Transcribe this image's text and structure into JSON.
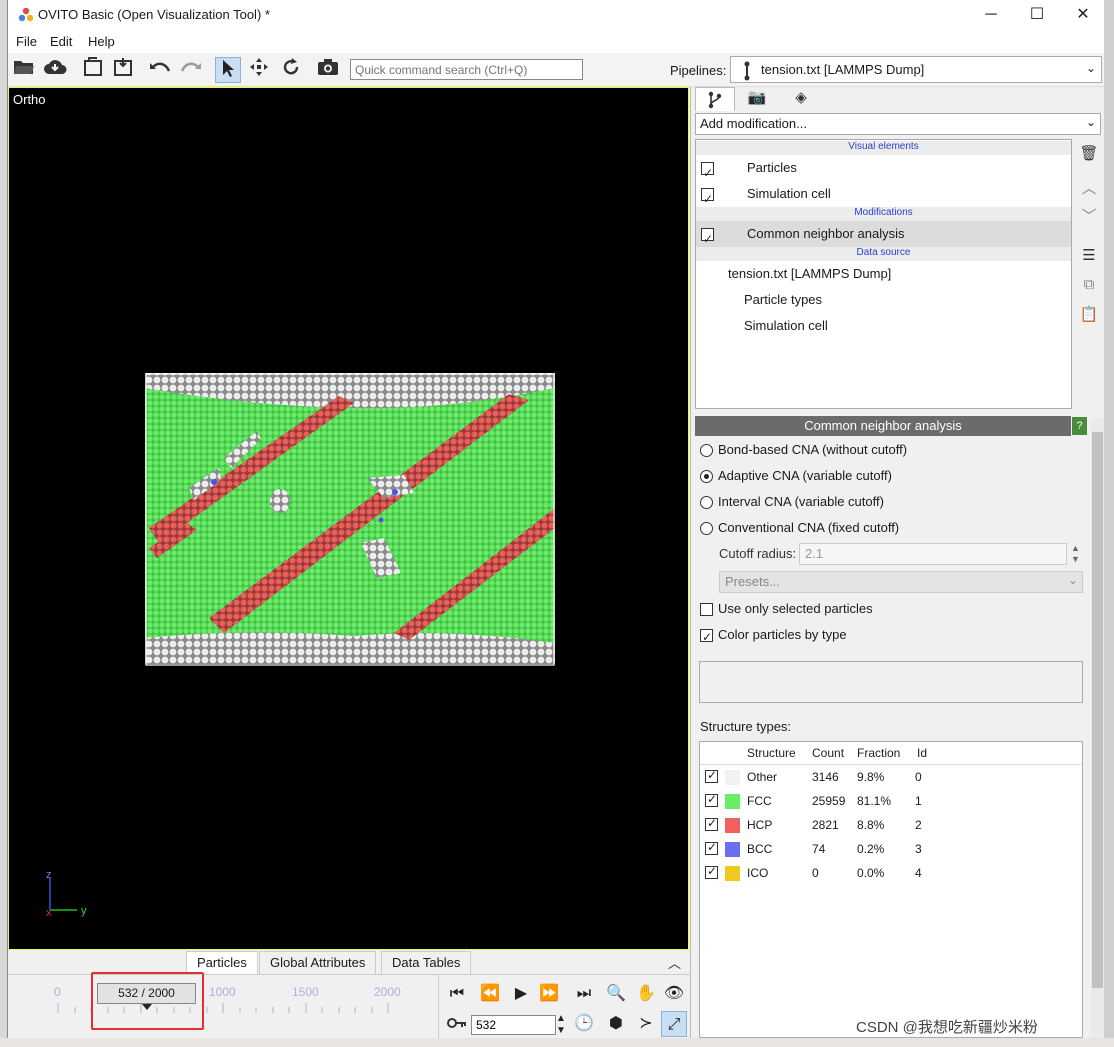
{
  "window": {
    "title": "OVITO Basic (Open Visualization Tool) *",
    "minimize": "─",
    "maximize": "☐",
    "close": "✕"
  },
  "menu": [
    "File",
    "Edit",
    "Help"
  ],
  "toolbar": {
    "search_placeholder": "Quick command search (Ctrl+Q)",
    "pipelines_label": "Pipelines:",
    "pipeline_value": "tension.txt [LAMMPS Dump]"
  },
  "viewport": {
    "label": "Ortho",
    "axis_z": "z",
    "axis_y": "y",
    "axis_x": "x"
  },
  "right_panel": {
    "add_modification": "Add modification...",
    "sections": {
      "visual_elements": "Visual elements",
      "modifications": "Modifications",
      "data_source": "Data source"
    },
    "visual_elements": [
      {
        "label": "Particles",
        "checked": true
      },
      {
        "label": "Simulation cell",
        "checked": true
      }
    ],
    "modifications": [
      {
        "label": "Common neighbor analysis",
        "checked": true,
        "selected": true
      }
    ],
    "data_source": {
      "file": "tension.txt [LAMMPS Dump]",
      "children": [
        "Particle types",
        "Simulation cell"
      ]
    }
  },
  "cna": {
    "header": "Common neighbor analysis",
    "help": "?",
    "modes": [
      {
        "label": "Bond-based CNA (without cutoff)",
        "selected": false
      },
      {
        "label": "Adaptive CNA (variable cutoff)",
        "selected": true
      },
      {
        "label": "Interval CNA (variable cutoff)",
        "selected": false
      },
      {
        "label": "Conventional CNA (fixed cutoff)",
        "selected": false
      }
    ],
    "cutoff_label": "Cutoff radius:",
    "cutoff_value": "2.1",
    "presets": "Presets...",
    "use_selected": {
      "label": "Use only selected particles",
      "checked": false
    },
    "color_by_type": {
      "label": "Color particles by type",
      "checked": true
    },
    "structure_types_label": "Structure types:",
    "table_headers": {
      "structure": "Structure",
      "count": "Count",
      "fraction": "Fraction",
      "id": "Id"
    },
    "structures": [
      {
        "name": "Other",
        "count": "3146",
        "fraction": "9.8%",
        "id": "0",
        "color": "#f2f2f2",
        "checked": true
      },
      {
        "name": "FCC",
        "count": "25959",
        "fraction": "81.1%",
        "id": "1",
        "color": "#66ee66",
        "checked": true
      },
      {
        "name": "HCP",
        "count": "2821",
        "fraction": "8.8%",
        "id": "2",
        "color": "#f06060",
        "checked": true
      },
      {
        "name": "BCC",
        "count": "74",
        "fraction": "0.2%",
        "id": "3",
        "color": "#6a6ef0",
        "checked": true
      },
      {
        "name": "ICO",
        "count": "0",
        "fraction": "0.0%",
        "id": "4",
        "color": "#f0c820",
        "checked": true
      }
    ]
  },
  "bottom": {
    "data_tabs": [
      "Particles",
      "Global Attributes",
      "Data Tables"
    ],
    "timeline_ticks": [
      "0",
      "1000",
      "1500",
      "2000"
    ],
    "frame_badge": "532 / 2000",
    "frame_spinner": "532"
  },
  "watermark": "CSDN @我想吃新疆炒米粉"
}
